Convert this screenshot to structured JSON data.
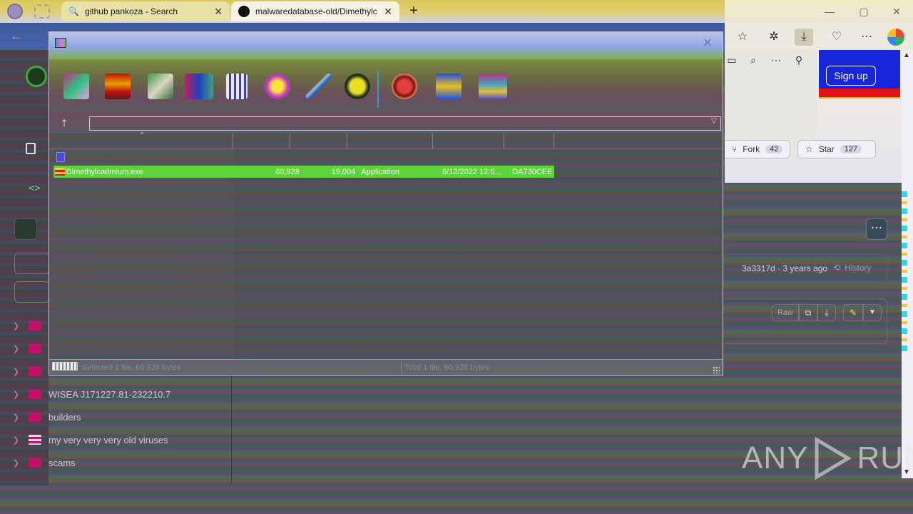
{
  "browser": {
    "tabs": [
      {
        "title": "github pankoza - Search",
        "icon": "search-icon"
      },
      {
        "title": "malwaredatabase-old/Dimethylc",
        "icon": "github-icon"
      }
    ],
    "new_tab": "+",
    "window_controls": {
      "minimize": "—",
      "maximize": "▢",
      "close": "✕"
    },
    "toolbar_icons": [
      "favorites-icon",
      "extensions-icon",
      "downloads-icon",
      "copilot-icon",
      "more-icon",
      "edge-icon"
    ]
  },
  "github": {
    "sign_up": "Sign up",
    "fork_label": "Fork",
    "fork_count": "42",
    "star_label": "Star",
    "star_count": "127",
    "commit_info": "3a3317d · 3 years ago",
    "history_label": "History",
    "raw_label": "Raw",
    "tree": [
      {
        "name": "",
        "kind": "folder"
      },
      {
        "name": "",
        "kind": "folder"
      },
      {
        "name": "",
        "kind": "folder"
      },
      {
        "name": "WISEA J171227.81-232210.7",
        "kind": "folder"
      },
      {
        "name": "builders",
        "kind": "folder"
      },
      {
        "name": "my very very very old viruses",
        "kind": "folder-open"
      },
      {
        "name": "scams",
        "kind": "folder"
      }
    ]
  },
  "archiver": {
    "toolbar_tools": [
      "add-icon",
      "extract-icon",
      "test-icon",
      "view-icon",
      "delete-icon",
      "find-icon",
      "wizard-icon",
      "info-icon",
      "virusscan-icon",
      "comment-icon",
      "sfx-icon"
    ],
    "path_value": "",
    "columns": [
      "",
      "",
      "",
      "",
      "",
      ""
    ],
    "file": {
      "name": "Dimethylcadmium.exe",
      "size": "60,928",
      "packed": "19,004",
      "type": "Application",
      "modified": "6/12/2022 12:0...",
      "crc": "DA730CEE"
    },
    "status_left": "Selected 1 file, 60,928 bytes",
    "status_right": "Total 1 file, 60,928 bytes"
  },
  "watermark": {
    "left": "ANY",
    "right": "RUN"
  },
  "colors": {
    "selection_row": "#5ed33a",
    "signup_bg": "#1626d8",
    "accent_red": "#e3121a"
  }
}
